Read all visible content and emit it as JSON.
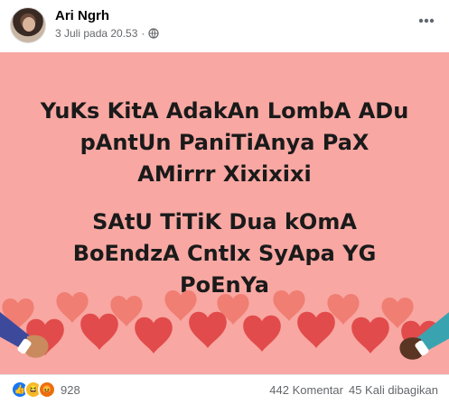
{
  "post": {
    "author": "Ari Ngrh",
    "timestamp": "3 Juli pada 20.53",
    "separator": "·",
    "privacy_icon": "globe-icon",
    "more_icon": "more-options-icon"
  },
  "image_text": {
    "line1": "YuKs KitA AdakAn LombA ADu",
    "line2": "pAntUn PaniTiAnya PaX",
    "line3": "AMirrr Xixixixi",
    "line4": "SAtU TiTiK Dua kOmA",
    "line5": "BoEndzA CntIx SyApa YG",
    "line6": "PoEnYa"
  },
  "colors": {
    "card_bg": "#f8a7a2",
    "heart": "#e24b4b",
    "heart_light": "#f07a6e",
    "like": "#1877f2",
    "haha": "#f7b928",
    "angry": "#e9710f"
  },
  "footer": {
    "reaction_count": "928",
    "comments": "442 Komentar",
    "shares": "45 Kali dibagikan"
  }
}
